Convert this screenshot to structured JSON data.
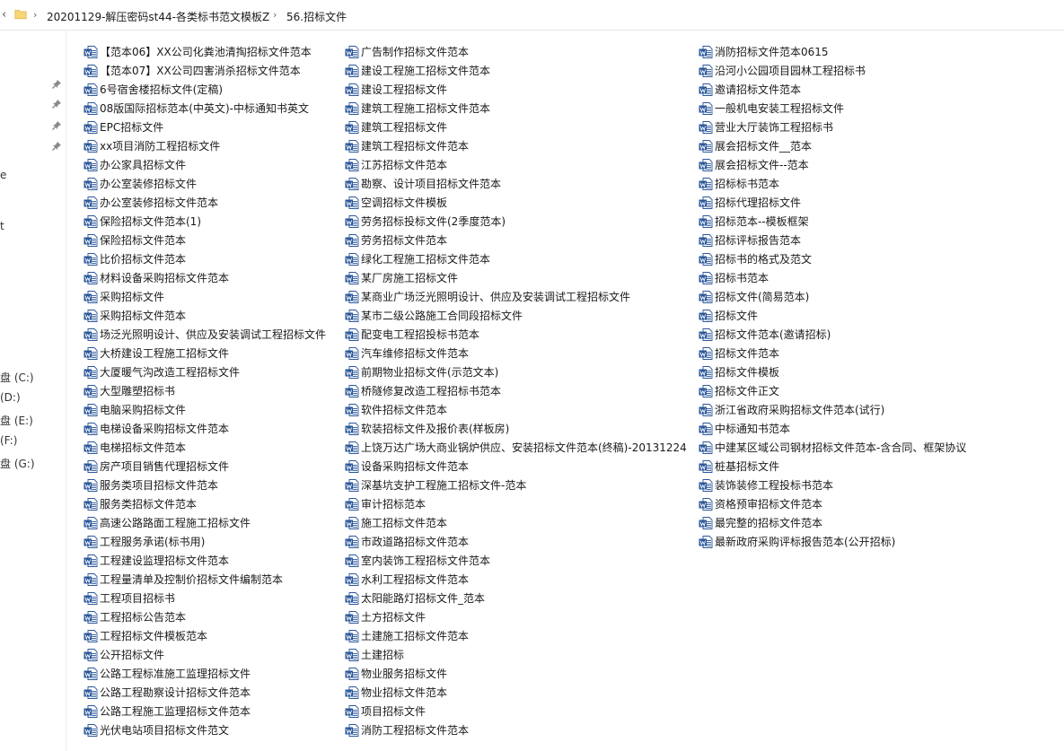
{
  "breadcrumb": {
    "items": [
      "20201129-解压密码st44-各类标书范文模板Z",
      "56.招标文件"
    ]
  },
  "nav": {
    "fragments": [
      "e",
      "t",
      "盘 (C:)",
      "(D:)",
      "盘 (E:)",
      "(F:)",
      "盘 (G:)"
    ]
  },
  "icons": {
    "doc": "word-document-icon",
    "docx": "word-docx-icon",
    "folder": "folder-icon",
    "pin": "pin-icon"
  },
  "colors": {
    "word_blue": "#2b579a",
    "folder_yellow": "#f8d775"
  },
  "columns": [
    {
      "files": [
        {
          "name": "【范本06】XX公司化粪池清掏招标文件范本",
          "type": "docx"
        },
        {
          "name": "【范本07】XX公司四害消杀招标文件范本",
          "type": "doc"
        },
        {
          "name": "6号宿舍楼招标文件(定稿)",
          "type": "doc"
        },
        {
          "name": "08版国际招标范本(中英文)-中标通知书英文",
          "type": "docx"
        },
        {
          "name": "EPC招标文件",
          "type": "doc"
        },
        {
          "name": "xx项目消防工程招标文件",
          "type": "doc"
        },
        {
          "name": "办公家具招标文件",
          "type": "doc"
        },
        {
          "name": "办公室装修招标文件",
          "type": "doc"
        },
        {
          "name": "办公室装修招标文件范本",
          "type": "doc"
        },
        {
          "name": "保险招标文件范本(1)",
          "type": "doc"
        },
        {
          "name": "保险招标文件范本",
          "type": "doc"
        },
        {
          "name": "比价招标文件范本",
          "type": "doc"
        },
        {
          "name": "材料设备采购招标文件范本",
          "type": "doc"
        },
        {
          "name": "采购招标文件",
          "type": "doc"
        },
        {
          "name": "采购招标文件范本",
          "type": "doc"
        },
        {
          "name": "场泛光照明设计、供应及安装调试工程招标文件",
          "type": "doc"
        },
        {
          "name": "大桥建设工程施工招标文件",
          "type": "doc"
        },
        {
          "name": "大厦暖气沟改造工程招标文件",
          "type": "doc"
        },
        {
          "name": "大型雕塑招标书",
          "type": "doc"
        },
        {
          "name": "电脑采购招标文件",
          "type": "doc"
        },
        {
          "name": "电梯设备采购招标文件范本",
          "type": "doc"
        },
        {
          "name": "电梯招标文件范本",
          "type": "doc"
        },
        {
          "name": "房产项目销售代理招标文件",
          "type": "doc"
        },
        {
          "name": "服务类项目招标文件范本",
          "type": "docx"
        },
        {
          "name": "服务类招标文件范本",
          "type": "doc"
        },
        {
          "name": "高速公路路面工程施工招标文件",
          "type": "doc"
        },
        {
          "name": "工程服务承诺(标书用)",
          "type": "doc"
        },
        {
          "name": "工程建设监理招标文件范本",
          "type": "doc"
        },
        {
          "name": "工程量清单及控制价招标文件编制范本",
          "type": "doc"
        },
        {
          "name": "工程项目招标书",
          "type": "doc"
        },
        {
          "name": "工程招标公告范本",
          "type": "doc"
        },
        {
          "name": "工程招标文件模板范本",
          "type": "doc"
        },
        {
          "name": "公开招标文件",
          "type": "docx"
        },
        {
          "name": "公路工程标准施工监理招标文件",
          "type": "docx"
        },
        {
          "name": "公路工程勘察设计招标文件范本",
          "type": "doc"
        },
        {
          "name": "公路工程施工监理招标文件范本",
          "type": "doc"
        },
        {
          "name": "光伏电站项目招标文件范文",
          "type": "doc"
        }
      ]
    },
    {
      "files": [
        {
          "name": "广告制作招标文件范本",
          "type": "doc"
        },
        {
          "name": "建设工程施工招标文件范本",
          "type": "doc"
        },
        {
          "name": "建设工程招标文件",
          "type": "doc"
        },
        {
          "name": "建筑工程施工招标文件范本",
          "type": "doc"
        },
        {
          "name": "建筑工程招标文件",
          "type": "doc"
        },
        {
          "name": "建筑工程招标文件范本",
          "type": "doc"
        },
        {
          "name": "江苏招标文件范本",
          "type": "doc"
        },
        {
          "name": "勘察、设计项目招标文件范本",
          "type": "doc"
        },
        {
          "name": "空调招标文件模板",
          "type": "doc"
        },
        {
          "name": "劳务招标投标文件(2季度范本)",
          "type": "doc"
        },
        {
          "name": "劳务招标文件范本",
          "type": "doc"
        },
        {
          "name": "绿化工程施工招标文件范本",
          "type": "doc"
        },
        {
          "name": "某厂房施工招标文件",
          "type": "doc"
        },
        {
          "name": "某商业广场泛光照明设计、供应及安装调试工程招标文件",
          "type": "doc"
        },
        {
          "name": "某市二级公路施工合同段招标文件",
          "type": "doc"
        },
        {
          "name": "配变电工程招投标书范本",
          "type": "doc"
        },
        {
          "name": "汽车维修招标文件范本",
          "type": "doc"
        },
        {
          "name": "前期物业招标文件(示范文本)",
          "type": "doc"
        },
        {
          "name": "桥隧修复改造工程招标书范本",
          "type": "doc"
        },
        {
          "name": "软件招标文件范本",
          "type": "doc"
        },
        {
          "name": "软装招标文件及报价表(样板房)",
          "type": "doc"
        },
        {
          "name": "上饶万达广场大商业锅炉供应、安装招标文件范本(终稿)-20131224",
          "type": "doc"
        },
        {
          "name": "设备采购招标文件范本",
          "type": "doc"
        },
        {
          "name": "深基坑支护工程施工招标文件-范本",
          "type": "doc"
        },
        {
          "name": "审计招标范本",
          "type": "doc"
        },
        {
          "name": "施工招标文件范本",
          "type": "doc"
        },
        {
          "name": "市政道路招标文件范本",
          "type": "doc"
        },
        {
          "name": "室内装饰工程招标文件范本",
          "type": "doc"
        },
        {
          "name": "水利工程招标文件范本",
          "type": "doc"
        },
        {
          "name": "太阳能路灯招标文件_范本",
          "type": "doc"
        },
        {
          "name": "土方招标文件",
          "type": "doc"
        },
        {
          "name": "土建施工招标文件范本",
          "type": "doc"
        },
        {
          "name": "土建招标",
          "type": "doc"
        },
        {
          "name": "物业服务招标文件",
          "type": "doc"
        },
        {
          "name": "物业招标文件范本",
          "type": "doc"
        },
        {
          "name": "项目招标文件",
          "type": "doc"
        },
        {
          "name": "消防工程招标文件范本",
          "type": "doc"
        }
      ]
    },
    {
      "files": [
        {
          "name": "消防招标文件范本0615",
          "type": "doc"
        },
        {
          "name": "沿河小公园项目园林工程招标书",
          "type": "doc"
        },
        {
          "name": "邀请招标文件范本",
          "type": "doc"
        },
        {
          "name": "一般机电安装工程招标文件",
          "type": "doc"
        },
        {
          "name": "营业大厅装饰工程招标书",
          "type": "doc"
        },
        {
          "name": "展会招标文件__范本",
          "type": "doc"
        },
        {
          "name": "展会招标文件--范本",
          "type": "doc"
        },
        {
          "name": "招标标书范本",
          "type": "docx"
        },
        {
          "name": "招标代理招标文件",
          "type": "doc"
        },
        {
          "name": "招标范本--模板框架",
          "type": "docx"
        },
        {
          "name": "招标评标报告范本",
          "type": "doc"
        },
        {
          "name": "招标书的格式及范文",
          "type": "doc"
        },
        {
          "name": "招标书范本",
          "type": "doc"
        },
        {
          "name": "招标文件(简易范本)",
          "type": "doc"
        },
        {
          "name": "招标文件",
          "type": "doc"
        },
        {
          "name": "招标文件范本(邀请招标)",
          "type": "doc"
        },
        {
          "name": "招标文件范本",
          "type": "doc"
        },
        {
          "name": "招标文件模板",
          "type": "doc"
        },
        {
          "name": "招标文件正文",
          "type": "docx"
        },
        {
          "name": "浙江省政府采购招标文件范本(试行)",
          "type": "doc"
        },
        {
          "name": "中标通知书范本",
          "type": "doc"
        },
        {
          "name": "中建某区域公司钢材招标文件范本-含合同、框架协议",
          "type": "docx"
        },
        {
          "name": "桩基招标文件",
          "type": "doc"
        },
        {
          "name": "装饰装修工程投标书范本",
          "type": "doc"
        },
        {
          "name": "资格预审招标文件范本",
          "type": "doc"
        },
        {
          "name": "最完整的招标文件范本",
          "type": "doc"
        },
        {
          "name": "最新政府采购评标报告范本(公开招标)",
          "type": "docx"
        }
      ]
    }
  ]
}
